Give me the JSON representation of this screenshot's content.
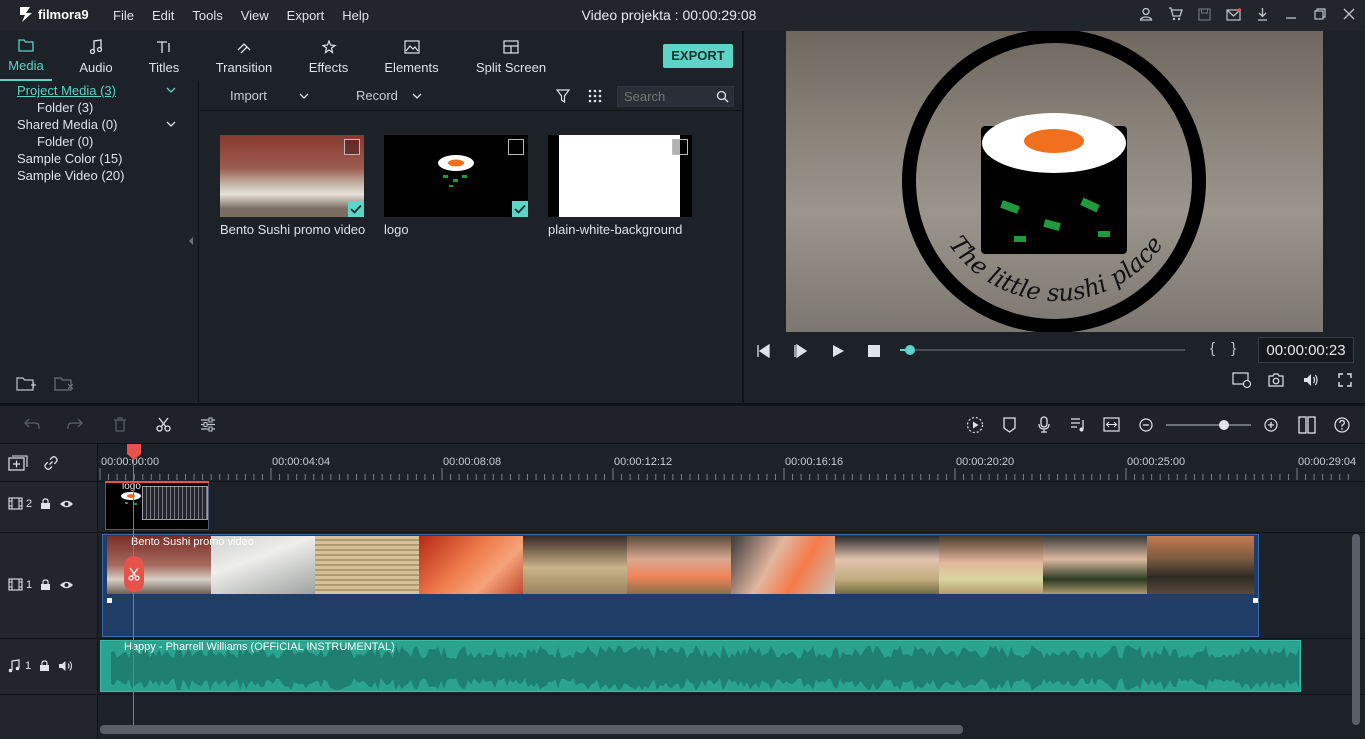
{
  "app": {
    "name": "filmora9",
    "project_title": "Video projekta : 00:00:29:08",
    "menu": [
      "File",
      "Edit",
      "Tools",
      "View",
      "Export",
      "Help"
    ]
  },
  "library": {
    "tabs": [
      {
        "label": "Media",
        "icon": "folder-icon"
      },
      {
        "label": "Audio",
        "icon": "music-note-icon"
      },
      {
        "label": "Titles",
        "icon": "text-icon"
      },
      {
        "label": "Transition",
        "icon": "transition-icon"
      },
      {
        "label": "Effects",
        "icon": "effects-icon"
      },
      {
        "label": "Elements",
        "icon": "image-icon"
      },
      {
        "label": "Split Screen",
        "icon": "split-screen-icon"
      }
    ],
    "export_label": "EXPORT",
    "tree": [
      {
        "label": "Project Media (3)"
      },
      {
        "label": "Folder (3)"
      },
      {
        "label": "Shared Media (0)"
      },
      {
        "label": "Folder (0)"
      },
      {
        "label": "Sample Color (15)"
      },
      {
        "label": "Sample Video (20)"
      }
    ],
    "import_label": "Import",
    "record_label": "Record",
    "search_placeholder": "Search",
    "media": [
      {
        "label": "Bento Sushi promo video"
      },
      {
        "label": "logo"
      },
      {
        "label": "plain-white-background"
      }
    ]
  },
  "preview": {
    "logo_text": "The little sushi place",
    "timecode": "00:00:00:23",
    "progress": 0.035,
    "brace_labels": "{ }"
  },
  "timeline": {
    "ruler": [
      "00:00:00:00",
      "00:00:04:04",
      "00:00:08:08",
      "00:00:12:12",
      "00:00:16:16",
      "00:00:20:20",
      "00:00:25:00",
      "00:00:29:04"
    ],
    "tracks": [
      {
        "label": "2"
      },
      {
        "label": "1"
      },
      {
        "label": "1"
      }
    ],
    "clips": {
      "logo": "logo",
      "video": "Bento Sushi promo video",
      "audio": "Happy - Pharrell Williams (OFFICIAL INSTRUMENTAL)"
    }
  },
  "colors": {
    "accent": "#5ed3c7",
    "playhead": "#e8524a",
    "video_clip": "#1f3d66",
    "audio_clip": "#2aa38f"
  }
}
